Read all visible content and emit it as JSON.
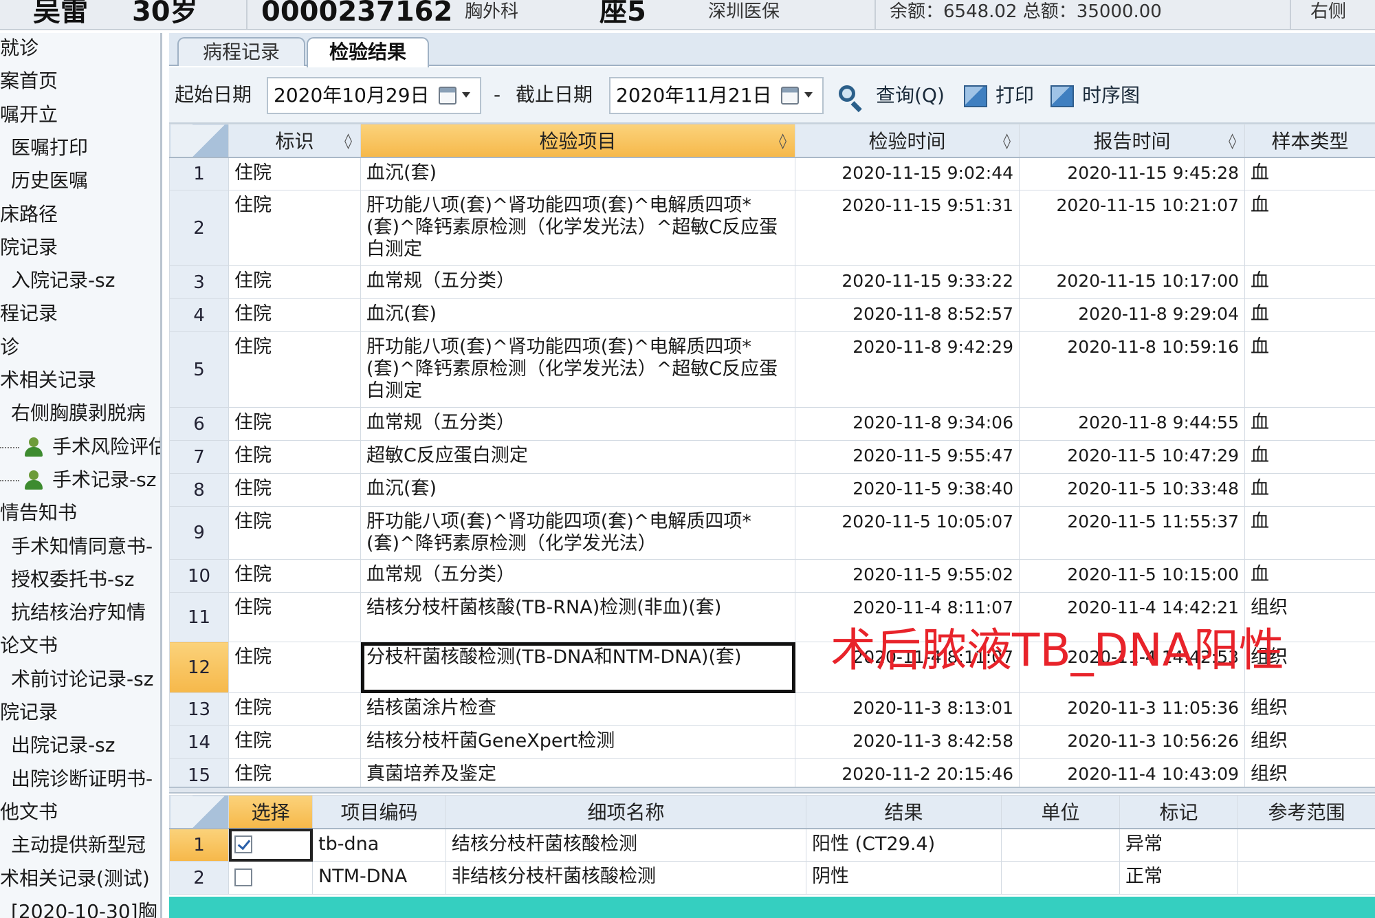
{
  "header": {
    "name": "吴雷",
    "age": "30岁",
    "patient_id": "0000237162",
    "id_suffix": "胸外科",
    "bed": "座5",
    "insurance": "深圳医保",
    "fees": "余额：6548.02  总额：35000.00",
    "right_text": "右侧"
  },
  "sidebar": {
    "items": [
      {
        "label": "就诊",
        "indent": 0
      },
      {
        "label": "案首页",
        "indent": 0
      },
      {
        "label": "嘱开立",
        "indent": 0
      },
      {
        "label": "医嘱打印",
        "indent": 1
      },
      {
        "label": "历史医嘱",
        "indent": 1
      },
      {
        "label": "床路径",
        "indent": 0
      },
      {
        "label": "院记录",
        "indent": 0
      },
      {
        "label": "入院记录-sz",
        "indent": 1
      },
      {
        "label": "程记录",
        "indent": 0
      },
      {
        "label": "诊",
        "indent": 0
      },
      {
        "label": "术相关记录",
        "indent": 0
      },
      {
        "label": "右侧胸膜剥脱病",
        "indent": 1
      },
      {
        "label": "手术风险评估",
        "indent": 2,
        "icon": "person-icon"
      },
      {
        "label": "手术记录-sz",
        "indent": 2,
        "icon": "person-icon"
      },
      {
        "label": "情告知书",
        "indent": 0
      },
      {
        "label": "手术知情同意书-",
        "indent": 1
      },
      {
        "label": "授权委托书-sz",
        "indent": 1
      },
      {
        "label": "抗结核治疗知情",
        "indent": 1
      },
      {
        "label": "论文书",
        "indent": 0
      },
      {
        "label": "术前讨论记录-sz",
        "indent": 1
      },
      {
        "label": "院记录",
        "indent": 0
      },
      {
        "label": "出院记录-sz",
        "indent": 1
      },
      {
        "label": "出院诊断证明书-",
        "indent": 1
      },
      {
        "label": "他文书",
        "indent": 0
      },
      {
        "label": "主动提供新型冠",
        "indent": 1
      },
      {
        "label": "术相关记录(测试)",
        "indent": 0
      },
      {
        "label": "[2020-10-30]胸",
        "indent": 1
      }
    ]
  },
  "tabs": [
    {
      "label": "病程记录",
      "active": false
    },
    {
      "label": "检验结果",
      "active": true
    }
  ],
  "toolbar": {
    "start_label": "起始日期",
    "start_date": "2020年10月29日",
    "separator": "-",
    "end_label": "截止日期",
    "end_date": "2020年11月21日",
    "query_label": "查询(Q)",
    "print_label": "打印",
    "timeline_label": "时序图"
  },
  "lab_table": {
    "columns": [
      "标识",
      "检验项目",
      "检验时间",
      "报告时间",
      "样本类型"
    ],
    "rows": [
      {
        "no": "1",
        "tag": "住院",
        "item": "血沉(套)",
        "test_time": "2020-11-15 9:02:44",
        "report_time": "2020-11-15 9:45:28",
        "sample": "血"
      },
      {
        "no": "2",
        "tag": "住院",
        "item": "肝功能八项(套)^肾功能四项(套)^电解质四项*(套)^降钙素原检测（化学发光法）^超敏C反应蛋白测定",
        "test_time": "2020-11-15 9:51:31",
        "report_time": "2020-11-15 10:21:07",
        "sample": "血"
      },
      {
        "no": "3",
        "tag": "住院",
        "item": "血常规（五分类）",
        "test_time": "2020-11-15 9:33:22",
        "report_time": "2020-11-15 10:17:00",
        "sample": "血"
      },
      {
        "no": "4",
        "tag": "住院",
        "item": "血沉(套)",
        "test_time": "2020-11-8 8:52:57",
        "report_time": "2020-11-8 9:29:04",
        "sample": "血"
      },
      {
        "no": "5",
        "tag": "住院",
        "item": "肝功能八项(套)^肾功能四项(套)^电解质四项*(套)^降钙素原检测（化学发光法）^超敏C反应蛋白测定",
        "test_time": "2020-11-8 9:42:29",
        "report_time": "2020-11-8 10:59:16",
        "sample": "血"
      },
      {
        "no": "6",
        "tag": "住院",
        "item": "血常规（五分类）",
        "test_time": "2020-11-8 9:34:06",
        "report_time": "2020-11-8 9:44:55",
        "sample": "血"
      },
      {
        "no": "7",
        "tag": "住院",
        "item": "超敏C反应蛋白测定",
        "test_time": "2020-11-5 9:55:47",
        "report_time": "2020-11-5 10:47:29",
        "sample": "血"
      },
      {
        "no": "8",
        "tag": "住院",
        "item": "血沉(套)",
        "test_time": "2020-11-5 9:38:40",
        "report_time": "2020-11-5 10:33:48",
        "sample": "血"
      },
      {
        "no": "9",
        "tag": "住院",
        "item": "肝功能八项(套)^肾功能四项(套)^电解质四项*(套)^降钙素原检测（化学发光法）",
        "test_time": "2020-11-5 10:05:07",
        "report_time": "2020-11-5 11:55:37",
        "sample": "血"
      },
      {
        "no": "10",
        "tag": "住院",
        "item": "血常规（五分类）",
        "test_time": "2020-11-5 9:55:02",
        "report_time": "2020-11-5 10:15:00",
        "sample": "血"
      },
      {
        "no": "11",
        "tag": "住院",
        "item": "结核分枝杆菌核酸(TB-RNA)检测(非血)(套)",
        "test_time": "2020-11-4 8:11:07",
        "report_time": "2020-11-4 14:42:21",
        "sample": "组织"
      },
      {
        "no": "12",
        "tag": "住院",
        "item": "分枝杆菌核酸检测(TB-DNA和NTM-DNA)(套)",
        "test_time": "2020-11-4 8:11:07",
        "report_time": "2020-11-4 14:42:53",
        "sample": "组织"
      },
      {
        "no": "13",
        "tag": "住院",
        "item": "结核菌涂片检查",
        "test_time": "2020-11-3 8:13:01",
        "report_time": "2020-11-3 11:05:36",
        "sample": "组织"
      },
      {
        "no": "14",
        "tag": "住院",
        "item": "结核分枝杆菌GeneXpert检测",
        "test_time": "2020-11-3 8:42:58",
        "report_time": "2020-11-3 10:56:26",
        "sample": "组织"
      },
      {
        "no": "15",
        "tag": "住院",
        "item": "真菌培养及鉴定",
        "test_time": "2020-11-2 20:15:46",
        "report_time": "2020-11-4 10:43:09",
        "sample": "组织"
      }
    ],
    "selected_row": "12"
  },
  "detail_table": {
    "columns": [
      "选择",
      "项目编码",
      "细项名称",
      "结果",
      "单位",
      "标记",
      "参考范围"
    ],
    "rows": [
      {
        "no": "1",
        "checked": true,
        "code": "tb-dna",
        "name": "结核分枝杆菌核酸检测",
        "result": "阳性  (CT29.4)",
        "unit": "",
        "flag": "异常",
        "range": ""
      },
      {
        "no": "2",
        "checked": false,
        "code": "NTM-DNA",
        "name": "非结核分枝杆菌核酸检测",
        "result": "阴性",
        "unit": "",
        "flag": "正常",
        "range": ""
      }
    ]
  },
  "annotation": "术后脓液TB_DNA阳性",
  "colors": {
    "sorted_header": "#f6b84a",
    "annotation_red": "#e8232a",
    "status_bar": "#35cfc0"
  }
}
